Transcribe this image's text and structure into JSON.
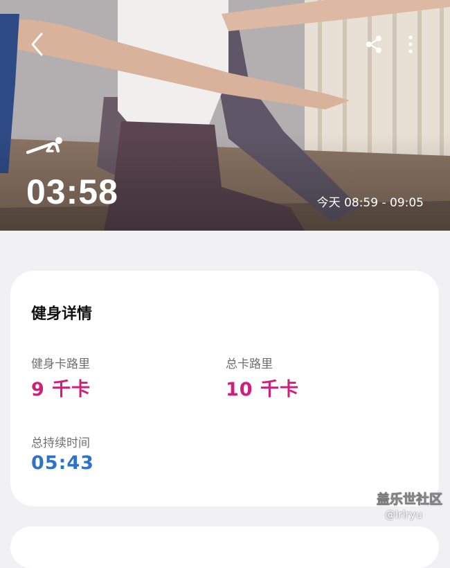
{
  "header": {
    "icons": {
      "back": "back-arrow-icon",
      "share": "share-icon",
      "more": "more-vertical-icon"
    }
  },
  "hero": {
    "workout_icon": "plank-workout-icon",
    "duration": "03:58",
    "time_range": "今天 08:59 - 09:05"
  },
  "details": {
    "title": "健身详情",
    "workout_calories": {
      "label": "健身卡路里",
      "value": "9 千卡"
    },
    "total_calories": {
      "label": "总卡路里",
      "value": "10 千卡"
    },
    "total_duration": {
      "label": "总持续时间",
      "value": "05:43"
    }
  },
  "watermark": {
    "site": "盖乐世社区",
    "user": "@lrlryu"
  },
  "colors": {
    "calorie": "#d21e7b",
    "duration": "#2e73c8",
    "card_bg": "#ffffff",
    "page_bg": "#f1f1f4"
  }
}
